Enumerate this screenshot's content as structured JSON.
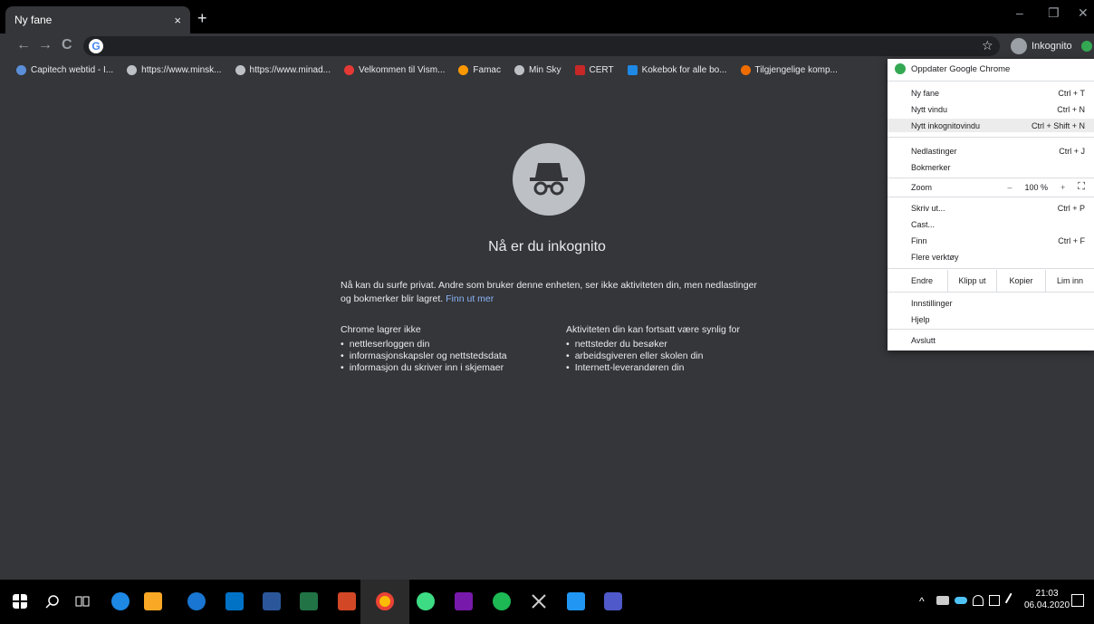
{
  "tab": {
    "title": "Ny fane",
    "close": "×",
    "new_tab": "+"
  },
  "window": {
    "minimize": "–",
    "maximize": "❐",
    "close": "✕"
  },
  "toolbar": {
    "back": "←",
    "forward": "→",
    "reload": "C",
    "star": "☆",
    "incognito_label": "Inkognito"
  },
  "bookmarks": [
    {
      "label": "Capitech webtid - I...",
      "color": "#5b8fd9"
    },
    {
      "label": "https://www.minsk...",
      "color": "#bdc1c6"
    },
    {
      "label": "https://www.minad...",
      "color": "#bdc1c6"
    },
    {
      "label": "Velkommen til Vism...",
      "color": "#e53935"
    },
    {
      "label": "Famac",
      "color": "#ff9800"
    },
    {
      "label": "Min Sky",
      "color": "#bdc1c6"
    },
    {
      "label": "CERT",
      "color": "#c62828"
    },
    {
      "label": "Kokebok for alle bo...",
      "color": "#1e88e5"
    },
    {
      "label": "Tilgjengelige komp...",
      "color": "#ef6c00"
    }
  ],
  "page": {
    "headline": "Nå er du inkognito",
    "description": "Nå kan du surfe privat. Andre som bruker denne enheten, ser ikke aktiviteten din, men nedlastinger og bokmerker blir lagret.",
    "learn_more": "Finn ut mer",
    "col1": {
      "title": "Chrome lagrer ikke",
      "items": [
        "nettleserloggen din",
        "informasjonskapsler og nettstedsdata",
        "informasjon du skriver inn i skjemaer"
      ]
    },
    "col2": {
      "title": "Aktiviteten din kan fortsatt være synlig for",
      "items": [
        "nettsteder du besøker",
        "arbeidsgiveren eller skolen din",
        "Internett-leverandøren din"
      ]
    }
  },
  "menu": {
    "update": "Oppdater Google Chrome",
    "new_tab": {
      "label": "Ny fane",
      "shortcut": "Ctrl + T"
    },
    "new_window": {
      "label": "Nytt vindu",
      "shortcut": "Ctrl + N"
    },
    "new_incognito": {
      "label": "Nytt inkognitovindu",
      "shortcut": "Ctrl + Shift + N"
    },
    "downloads": {
      "label": "Nedlastinger",
      "shortcut": "Ctrl + J"
    },
    "bookmarks": {
      "label": "Bokmerker"
    },
    "zoom": {
      "label": "Zoom",
      "minus": "–",
      "value": "100 %",
      "plus": "+",
      "fullscreen": "⛶"
    },
    "print": {
      "label": "Skriv ut...",
      "shortcut": "Ctrl + P"
    },
    "cast": {
      "label": "Cast..."
    },
    "find": {
      "label": "Finn",
      "shortcut": "Ctrl + F"
    },
    "more_tools": {
      "label": "Flere verktøy"
    },
    "edit": {
      "label": "Endre",
      "cut": "Klipp ut",
      "copy": "Kopier",
      "paste": "Lim inn"
    },
    "settings": {
      "label": "Innstillinger"
    },
    "help": {
      "label": "Hjelp"
    },
    "exit": {
      "label": "Avslutt"
    }
  },
  "taskbar": {
    "time": "21:03",
    "date": "06.04.2020",
    "icons": [
      "windows-icon",
      "search-icon",
      "task-view-icon",
      "edge-icon",
      "file-explorer-icon",
      "ie-icon",
      "outlook-icon",
      "word-icon",
      "excel-icon",
      "powerpoint-icon",
      "chrome-icon",
      "android-icon",
      "onenote-icon",
      "spotify-icon",
      "tools-icon",
      "notes-icon",
      "teams-icon"
    ]
  }
}
